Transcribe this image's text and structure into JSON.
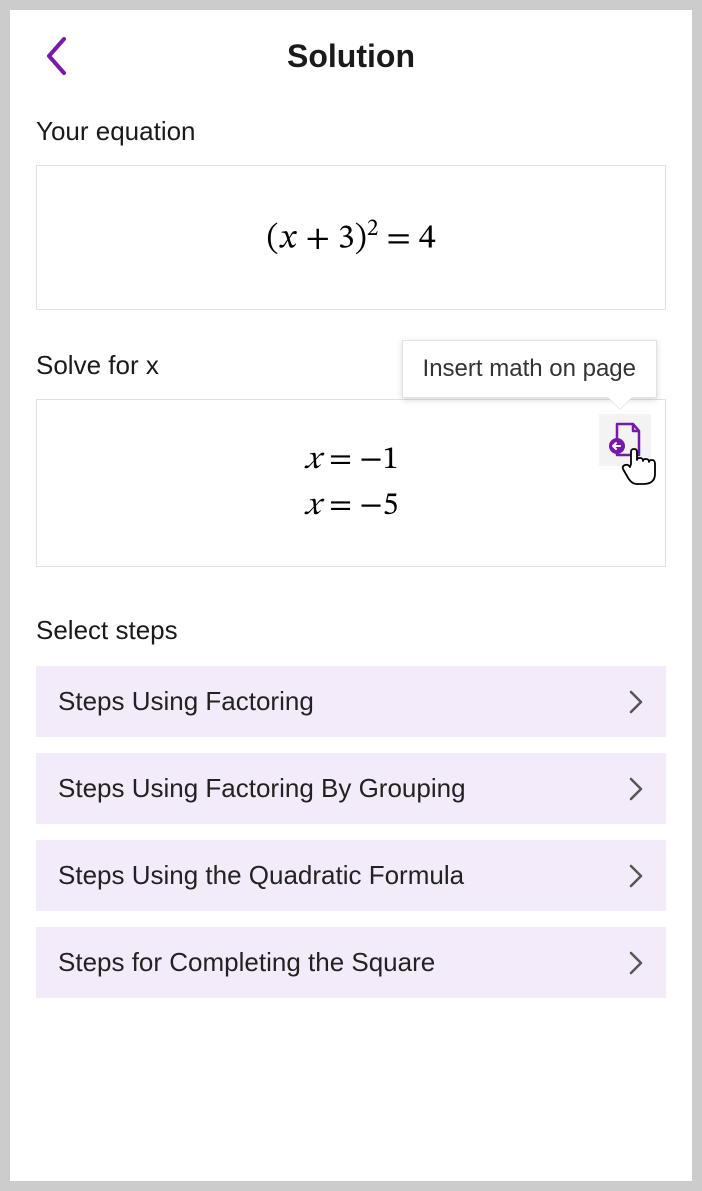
{
  "header": {
    "title": "Solution"
  },
  "sections": {
    "your_equation_label": "Your equation",
    "solve_for_label": "Solve for x",
    "select_steps_label": "Select steps"
  },
  "equation": {
    "latex_plain": "(x + 3)² = 4",
    "base": "(𝑥 + 3)",
    "exp": "2",
    "rhs": "= 4"
  },
  "solutions": [
    {
      "lhs": "𝑥",
      "eq": "=",
      "rhs": "−1"
    },
    {
      "lhs": "𝑥",
      "eq": "=",
      "rhs": "−5"
    }
  ],
  "tooltip": {
    "text": "Insert math on page"
  },
  "steps": [
    {
      "label": "Steps Using Factoring"
    },
    {
      "label": "Steps Using Factoring By Grouping"
    },
    {
      "label": "Steps Using the Quadratic Formula"
    },
    {
      "label": "Steps for Completing the Square"
    }
  ],
  "colors": {
    "accent": "#7719aa",
    "step_bg": "#f4ebfa"
  }
}
